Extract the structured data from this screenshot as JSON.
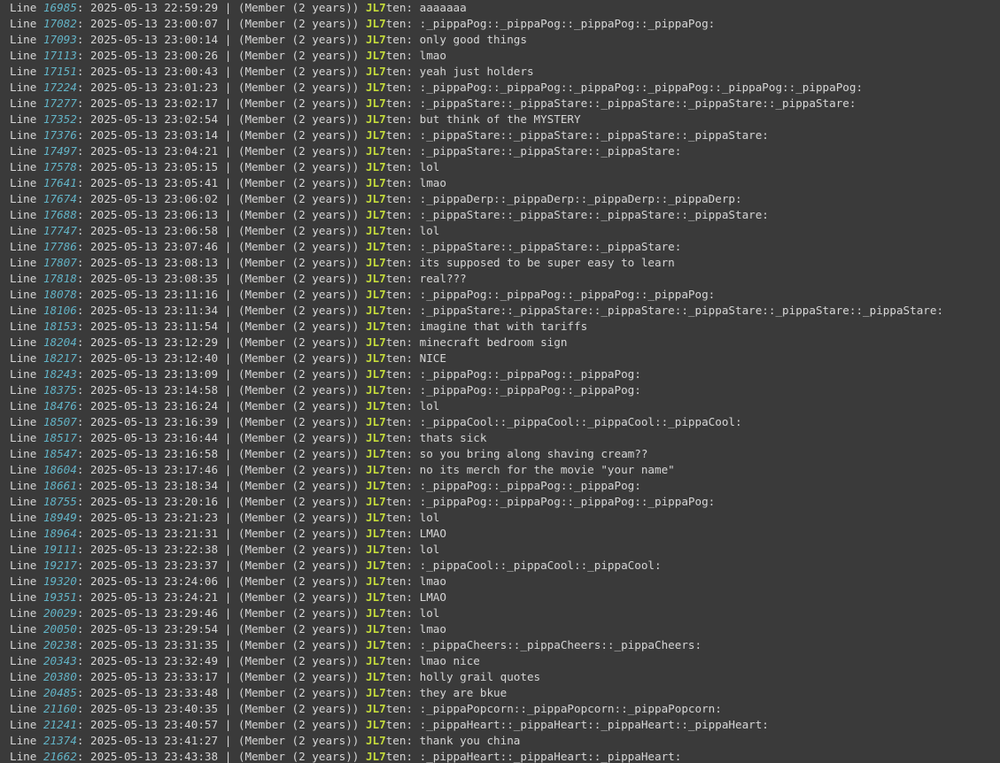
{
  "labels": {
    "line_word": "Line",
    "separator": "|",
    "badge": "(Member (2 years))",
    "user_prefix": "JL7",
    "user_suffix": "ten"
  },
  "colors": {
    "background": "#3a3a3a",
    "text": "#d6d6d6",
    "line_number": "#62b3c6",
    "username": "#c6dd3a"
  },
  "rows": [
    {
      "line": "16985",
      "time": "2025-05-13 22:59:29",
      "msg": "aaaaaaa"
    },
    {
      "line": "17082",
      "time": "2025-05-13 23:00:07",
      "msg": ":_pippaPog::_pippaPog::_pippaPog::_pippaPog:"
    },
    {
      "line": "17093",
      "time": "2025-05-13 23:00:14",
      "msg": "only good things"
    },
    {
      "line": "17113",
      "time": "2025-05-13 23:00:26",
      "msg": "lmao"
    },
    {
      "line": "17151",
      "time": "2025-05-13 23:00:43",
      "msg": "yeah just holders"
    },
    {
      "line": "17224",
      "time": "2025-05-13 23:01:23",
      "msg": ":_pippaPog::_pippaPog::_pippaPog::_pippaPog::_pippaPog::_pippaPog:"
    },
    {
      "line": "17277",
      "time": "2025-05-13 23:02:17",
      "msg": ":_pippaStare::_pippaStare::_pippaStare::_pippaStare::_pippaStare:"
    },
    {
      "line": "17352",
      "time": "2025-05-13 23:02:54",
      "msg": "but think of the MYSTERY"
    },
    {
      "line": "17376",
      "time": "2025-05-13 23:03:14",
      "msg": ":_pippaStare::_pippaStare::_pippaStare::_pippaStare:"
    },
    {
      "line": "17497",
      "time": "2025-05-13 23:04:21",
      "msg": ":_pippaStare::_pippaStare::_pippaStare:"
    },
    {
      "line": "17578",
      "time": "2025-05-13 23:05:15",
      "msg": "lol"
    },
    {
      "line": "17641",
      "time": "2025-05-13 23:05:41",
      "msg": "lmao"
    },
    {
      "line": "17674",
      "time": "2025-05-13 23:06:02",
      "msg": ":_pippaDerp::_pippaDerp::_pippaDerp::_pippaDerp:"
    },
    {
      "line": "17688",
      "time": "2025-05-13 23:06:13",
      "msg": ":_pippaStare::_pippaStare::_pippaStare::_pippaStare:"
    },
    {
      "line": "17747",
      "time": "2025-05-13 23:06:58",
      "msg": "lol"
    },
    {
      "line": "17786",
      "time": "2025-05-13 23:07:46",
      "msg": ":_pippaStare::_pippaStare::_pippaStare:"
    },
    {
      "line": "17807",
      "time": "2025-05-13 23:08:13",
      "msg": "its supposed to be super easy to learn"
    },
    {
      "line": "17818",
      "time": "2025-05-13 23:08:35",
      "msg": "real???"
    },
    {
      "line": "18078",
      "time": "2025-05-13 23:11:16",
      "msg": ":_pippaPog::_pippaPog::_pippaPog::_pippaPog:"
    },
    {
      "line": "18106",
      "time": "2025-05-13 23:11:34",
      "msg": ":_pippaStare::_pippaStare::_pippaStare::_pippaStare::_pippaStare::_pippaStare:"
    },
    {
      "line": "18153",
      "time": "2025-05-13 23:11:54",
      "msg": "imagine that with tariffs"
    },
    {
      "line": "18204",
      "time": "2025-05-13 23:12:29",
      "msg": "minecraft bedroom sign"
    },
    {
      "line": "18217",
      "time": "2025-05-13 23:12:40",
      "msg": "NICE"
    },
    {
      "line": "18243",
      "time": "2025-05-13 23:13:09",
      "msg": ":_pippaPog::_pippaPog::_pippaPog:"
    },
    {
      "line": "18375",
      "time": "2025-05-13 23:14:58",
      "msg": ":_pippaPog::_pippaPog::_pippaPog:"
    },
    {
      "line": "18476",
      "time": "2025-05-13 23:16:24",
      "msg": "lol"
    },
    {
      "line": "18507",
      "time": "2025-05-13 23:16:39",
      "msg": ":_pippaCool::_pippaCool::_pippaCool::_pippaCool:"
    },
    {
      "line": "18517",
      "time": "2025-05-13 23:16:44",
      "msg": "thats sick"
    },
    {
      "line": "18547",
      "time": "2025-05-13 23:16:58",
      "msg": "so you bring along shaving cream??"
    },
    {
      "line": "18604",
      "time": "2025-05-13 23:17:46",
      "msg": "no its merch for the movie \"your name\""
    },
    {
      "line": "18661",
      "time": "2025-05-13 23:18:34",
      "msg": ":_pippaPog::_pippaPog::_pippaPog:"
    },
    {
      "line": "18755",
      "time": "2025-05-13 23:20:16",
      "msg": ":_pippaPog::_pippaPog::_pippaPog::_pippaPog:"
    },
    {
      "line": "18949",
      "time": "2025-05-13 23:21:23",
      "msg": "lol"
    },
    {
      "line": "18964",
      "time": "2025-05-13 23:21:31",
      "msg": "LMAO"
    },
    {
      "line": "19111",
      "time": "2025-05-13 23:22:38",
      "msg": "lol"
    },
    {
      "line": "19217",
      "time": "2025-05-13 23:23:37",
      "msg": ":_pippaCool::_pippaCool::_pippaCool:"
    },
    {
      "line": "19320",
      "time": "2025-05-13 23:24:06",
      "msg": "lmao"
    },
    {
      "line": "19351",
      "time": "2025-05-13 23:24:21",
      "msg": "LMAO"
    },
    {
      "line": "20029",
      "time": "2025-05-13 23:29:46",
      "msg": "lol"
    },
    {
      "line": "20050",
      "time": "2025-05-13 23:29:54",
      "msg": "lmao"
    },
    {
      "line": "20238",
      "time": "2025-05-13 23:31:35",
      "msg": ":_pippaCheers::_pippaCheers::_pippaCheers:"
    },
    {
      "line": "20343",
      "time": "2025-05-13 23:32:49",
      "msg": "lmao nice"
    },
    {
      "line": "20380",
      "time": "2025-05-13 23:33:17",
      "msg": "holly grail quotes"
    },
    {
      "line": "20485",
      "time": "2025-05-13 23:33:48",
      "msg": "they are bkue"
    },
    {
      "line": "21160",
      "time": "2025-05-13 23:40:35",
      "msg": ":_pippaPopcorn::_pippaPopcorn::_pippaPopcorn:"
    },
    {
      "line": "21241",
      "time": "2025-05-13 23:40:57",
      "msg": ":_pippaHeart::_pippaHeart::_pippaHeart::_pippaHeart:"
    },
    {
      "line": "21374",
      "time": "2025-05-13 23:41:27",
      "msg": "thank you china"
    },
    {
      "line": "21662",
      "time": "2025-05-13 23:43:38",
      "msg": ":_pippaHeart::_pippaHeart::_pippaHeart:"
    }
  ]
}
